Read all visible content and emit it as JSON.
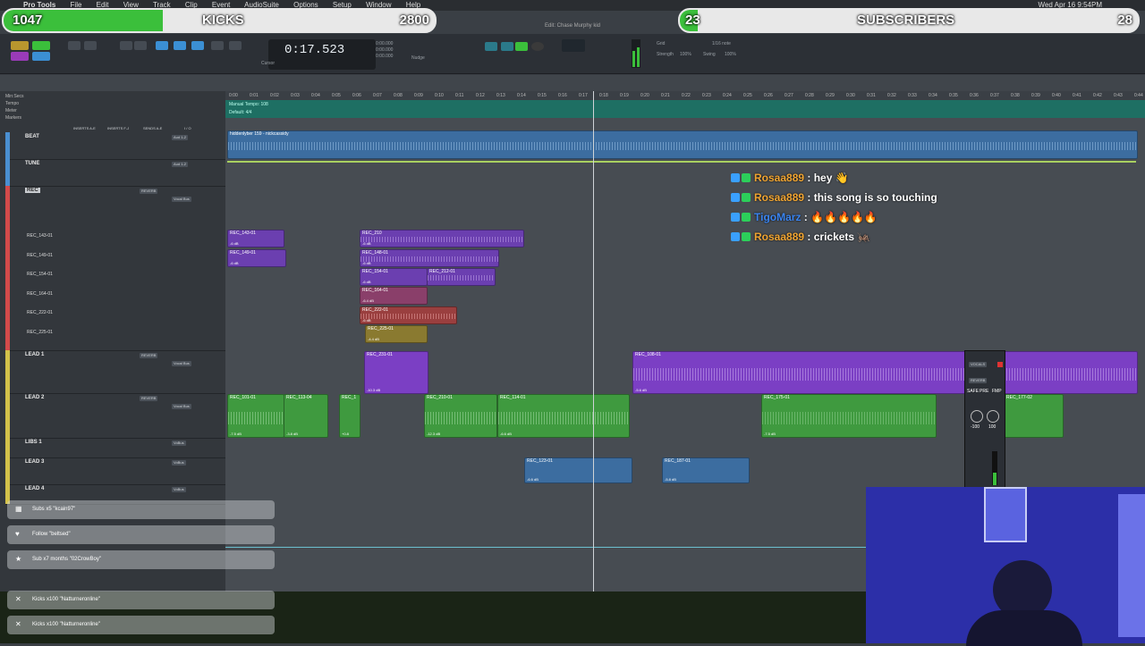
{
  "menubar": {
    "items": [
      "Pro Tools",
      "File",
      "Edit",
      "View",
      "Track",
      "Clip",
      "Event",
      "AudioSuite",
      "Options",
      "Setup",
      "Window",
      "Help"
    ],
    "clock": "Wed Apr 16 9:54PM"
  },
  "window_title": "Edit: Chase Murphy kid",
  "goals": {
    "kicks": {
      "current": "1047",
      "label": "KICKS",
      "target": "2800",
      "progress": 0.37
    },
    "subs": {
      "current": "23",
      "label": "SUBSCRIBERS",
      "target": "28",
      "progress": 0.04
    }
  },
  "counter": {
    "time": "0:17.523",
    "start": "0:00.000",
    "end": "0:00.000",
    "length": "0:00.000",
    "cursor_label": "Cursor",
    "nudge_label": "Nudge",
    "grid_label": "Grid",
    "grid_value": "1/16 note",
    "strength_label": "Strength",
    "strength_value": "100%",
    "swing_label": "Swing",
    "swing_value": "100%"
  },
  "ruler_rows": [
    "Min:Secs",
    "Tempo",
    "Meter",
    "Markers"
  ],
  "tempo_label": "Manual Tempo: 108",
  "meter_label": "Default: 4/4",
  "ruler_ticks": [
    "0:00",
    "0:01",
    "0:02",
    "0:03",
    "0:04",
    "0:05",
    "0:06",
    "0:07",
    "0:08",
    "0:09",
    "0:10",
    "0:11",
    "0:12",
    "0:13",
    "0:14",
    "0:15",
    "0:16",
    "0:17",
    "0:18",
    "0:19",
    "0:20",
    "0:21",
    "0:22",
    "0:23",
    "0:24",
    "0:25",
    "0:26",
    "0:27",
    "0:28",
    "0:29",
    "0:30",
    "0:31",
    "0:32",
    "0:33",
    "0:34",
    "0:35",
    "0:36",
    "0:37",
    "0:38",
    "0:39",
    "0:40",
    "0:41",
    "0:42",
    "0:43",
    "0:44"
  ],
  "column_headers": [
    "INSERTS A-E",
    "INSERTS F-J",
    "SENDS A-E",
    "I / O"
  ],
  "tracks": [
    {
      "name": "BEAT",
      "color": "#4a8fd1",
      "plugin": "",
      "io": "Aud 1-2"
    },
    {
      "name": "TUNE",
      "color": "#4a8fd1",
      "plugin": "",
      "io": "Aud 1-2"
    },
    {
      "name": "REC",
      "color": "#d24a4a",
      "plugin": "REVERB",
      "io": "Vocal Bus"
    },
    {
      "name": "LEAD 1",
      "color": "#d4c24a",
      "plugin": "REVERB",
      "io": "Vocal Bus"
    },
    {
      "name": "LEAD 2",
      "color": "#d4c24a",
      "plugin": "REVERB",
      "io": "Vocal Bus"
    },
    {
      "name": "LIBS 1",
      "color": "#d4c24a",
      "plugin": "",
      "io": "VoBus"
    },
    {
      "name": "LEAD 3",
      "color": "#d4c24a",
      "plugin": "",
      "io": "VoBus"
    },
    {
      "name": "LEAD 4",
      "color": "#d4c24a",
      "plugin": "",
      "io": "VoBus"
    }
  ],
  "playlist_lanes": [
    "REC_143-01",
    "REC_149-01",
    "REC_154-01",
    "REC_164-01",
    "REC_222-01",
    "REC_225-01"
  ],
  "beat_clip": "hiddenlyber 159 - nickcassidy",
  "clips": {
    "c1": {
      "name": "REC_143-01",
      "db": "-6 dB"
    },
    "c2": {
      "name": "REC_149-01",
      "db": "-6 dB"
    },
    "c3": {
      "name": "REC_210",
      "db": "-6 dB"
    },
    "c4": {
      "name": "REC_148-01",
      "db": "-6 dB"
    },
    "c5": {
      "name": "REC_154-01",
      "db": "-6 dB"
    },
    "c6": {
      "name": "REC_212-01",
      "db": ""
    },
    "c7": {
      "name": "REC_164-01",
      "db": "-6.4 dB"
    },
    "c8": {
      "name": "REC_222-01",
      "db": "-6 dB"
    },
    "c9": {
      "name": "REC_225-01",
      "db": "-4.4 dB"
    },
    "c10": {
      "name": "REC_231-01",
      "db": "-10.3 dB"
    },
    "c11": {
      "name": "REC_108-01",
      "db": "-5.6 dB"
    },
    "c12": {
      "name": "REC_101-01",
      "db": "-7.5 dB"
    },
    "c13": {
      "name": "REC_113-04",
      "db": "-3.8 dB"
    },
    "c14": {
      "name": "REC_1",
      "db": "+0.8"
    },
    "c15": {
      "name": "REC_210-01",
      "db": "-12.3 dB"
    },
    "c16": {
      "name": "REC_114-01",
      "db": "-6.6 dB"
    },
    "c17": {
      "name": "REC_175-01",
      "db": "-7.5 dB"
    },
    "c18": {
      "name": "REC_123-01",
      "db": "-6.6 dB"
    },
    "c19": {
      "name": "REC_187-01",
      "db": "-5.8 dB"
    },
    "c20": {
      "name": "REC_177-02",
      "db": ""
    }
  },
  "chat": [
    {
      "user": "Rosaa889",
      "message": ": hey 👋",
      "color": "orange"
    },
    {
      "user": "Rosaa889",
      "message": ": this song is so touching",
      "color": "orange"
    },
    {
      "user": "TigoMarz",
      "message": ": 🔥🔥🔥🔥🔥",
      "color": "blue"
    },
    {
      "user": "Rosaa889",
      "message": ": crickets 🦗",
      "color": "orange"
    }
  ],
  "alerts": [
    {
      "icon": "gift-icon",
      "text": "Subs x5 \"kcain97\""
    },
    {
      "icon": "heart-icon",
      "text": "Follow \"beltsed\""
    },
    {
      "icon": "star-icon",
      "text": "Sub x7 months \"02CrowBoy\""
    },
    {
      "icon": "kick-icon",
      "text": "Kicks x100 \"Natturneronline\""
    },
    {
      "icon": "kick-icon",
      "text": "Kicks x100 \"Natturneronline\""
    }
  ],
  "mixer_strip": {
    "name": "VOCALS",
    "insert": "REVERB",
    "btns": [
      "SAFE",
      "PRE",
      "FMP"
    ],
    "vals": [
      "-100",
      "100"
    ]
  },
  "colors": {
    "goal_fill": "#3bbf3b",
    "purple_clip": "#7b3fc4",
    "green_clip": "#3f9a3f",
    "blue_clip": "#3c6da0",
    "tempo_bar": "#1e6f63"
  }
}
